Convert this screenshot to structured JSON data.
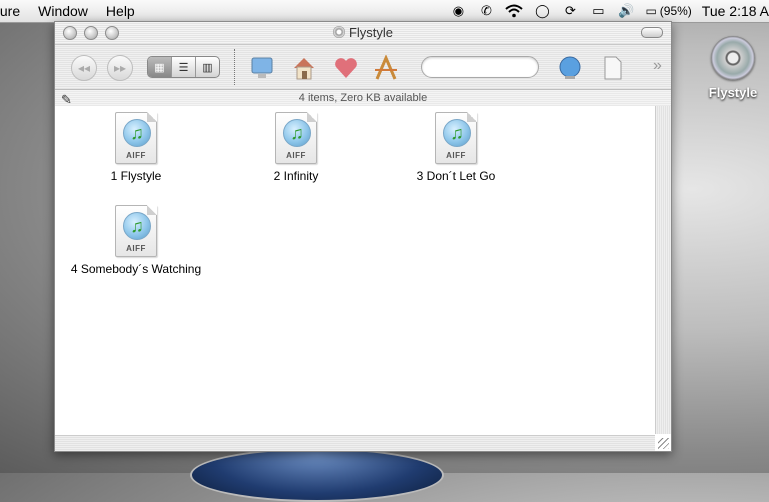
{
  "menubar": {
    "items": [
      "ture",
      "Window",
      "Help"
    ],
    "battery_text": "(95%)",
    "clock": "Tue 2:18 A"
  },
  "desktop": {
    "disk_label": "Flystyle"
  },
  "window": {
    "title": "Flystyle",
    "status": "4 items, Zero KB available",
    "files": [
      {
        "name": "1 Flystyle",
        "type": "AIFF"
      },
      {
        "name": "2 Infinity",
        "type": "AIFF"
      },
      {
        "name": "3 Don´t Let Go",
        "type": "AIFF"
      },
      {
        "name": "4 Somebody´s Watching",
        "type": "AIFF"
      }
    ]
  }
}
